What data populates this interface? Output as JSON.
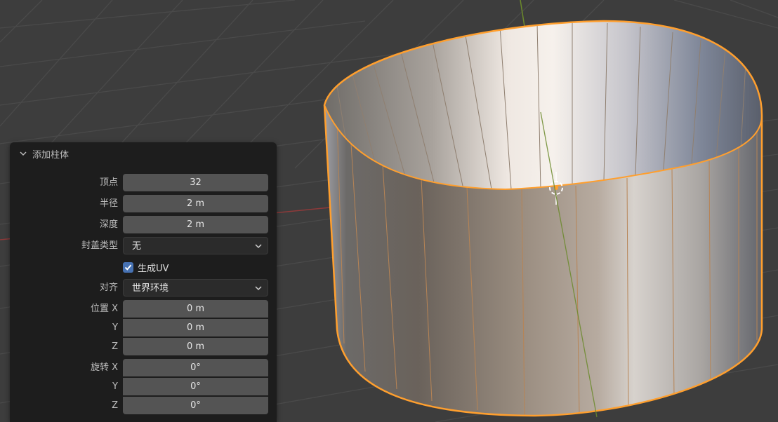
{
  "panel": {
    "title": "添加柱体",
    "vertices_label": "顶点",
    "vertices_value": "32",
    "radius_label": "半径",
    "radius_value": "2 m",
    "depth_label": "深度",
    "depth_value": "2 m",
    "cap_fill_label": "封盖类型",
    "cap_fill_value": "无",
    "generate_uv_label": "生成UV",
    "generate_uv_checked": true,
    "align_label": "对齐",
    "align_value": "世界环境",
    "location_label": "位置 X",
    "location_x": "0 m",
    "location_y_label": "Y",
    "location_y": "0 m",
    "location_z_label": "Z",
    "location_z": "0 m",
    "rotation_label": "旋转 X",
    "rotation_x": "0°",
    "rotation_y_label": "Y",
    "rotation_y": "0°",
    "rotation_z_label": "Z",
    "rotation_z": "0°"
  },
  "colors": {
    "viewport_bg": "#3d3d3d",
    "selection_outline": "#ff9f2e",
    "accent": "#4772b3"
  }
}
